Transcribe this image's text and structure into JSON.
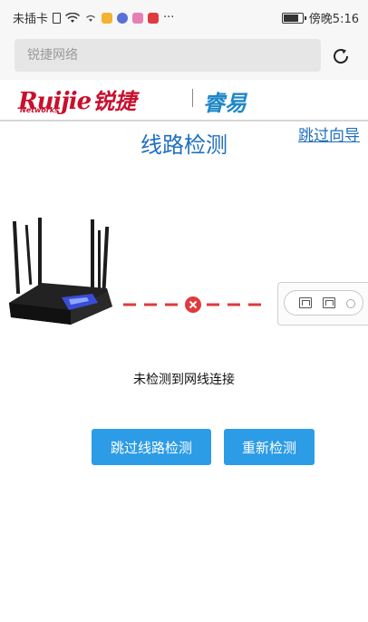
{
  "status_bar": {
    "carrier": "未插卡",
    "time": "傍晚5:16",
    "more": "···",
    "battery_level": 0.9
  },
  "browser": {
    "url_placeholder": "锐捷网络"
  },
  "header": {
    "brand_word": "Ruijie",
    "brand_cn": "锐捷",
    "brand_sub": "Networks",
    "partner_logo": "睿易"
  },
  "page": {
    "title": "线路检测",
    "skip_guide": "跳过向导",
    "status_message": "未检测到网线连接",
    "skip_button": "跳过线路检测",
    "retry_button": "重新检测"
  },
  "colors": {
    "title_blue": "#1f6fbf",
    "button_blue": "#2d9ce6",
    "error_red": "#e0393e",
    "brand_red": "#c8102e",
    "ruiyi_blue": "#1e88c8"
  },
  "icons": {
    "reload": "reload-icon",
    "error": "error-x-icon",
    "wifi": "wifi-icon"
  }
}
